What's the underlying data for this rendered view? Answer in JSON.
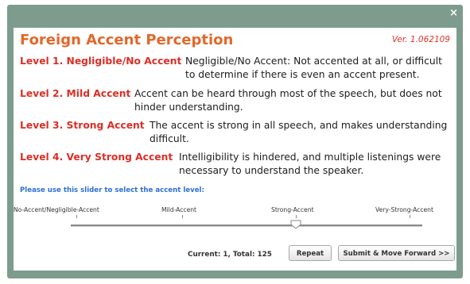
{
  "dialog": {
    "close_glyph": "×",
    "title": "Foreign Accent Perception",
    "version": "Ver. 1.062109"
  },
  "levels": [
    {
      "name": "Level 1. Negligible/No Accent",
      "description": "Negligible/No Accent: Not accented at all, or difficult to determine if there is even an accent present."
    },
    {
      "name": "Level 2. Mild Accent",
      "description": "Accent can be heard through most of the speech, but does not hinder understanding."
    },
    {
      "name": "Level 3. Strong Accent",
      "description": "The accent is strong in all speech, and makes understanding difficult."
    },
    {
      "name": "Level 4. Very Strong Accent",
      "description": "Intelligibility is hindered, and multiple listenings were necessary to understand the speaker."
    }
  ],
  "slider": {
    "prompt": "Please use this slider to select the accent level:",
    "labels": [
      "No-Accent/Negligible-Accent",
      "Mild-Accent",
      "Strong-Accent",
      "Very-Strong-Accent"
    ],
    "value_fraction": 0.64
  },
  "footer": {
    "status": "Current: 1, Total: 125",
    "repeat_label": "Repeat",
    "submit_label": "Submit & Move Forward >>"
  },
  "colors": {
    "frame": "#7d9c8e",
    "title": "#e2682c",
    "level_name": "#dd2e25",
    "prompt": "#2c6fd6"
  }
}
